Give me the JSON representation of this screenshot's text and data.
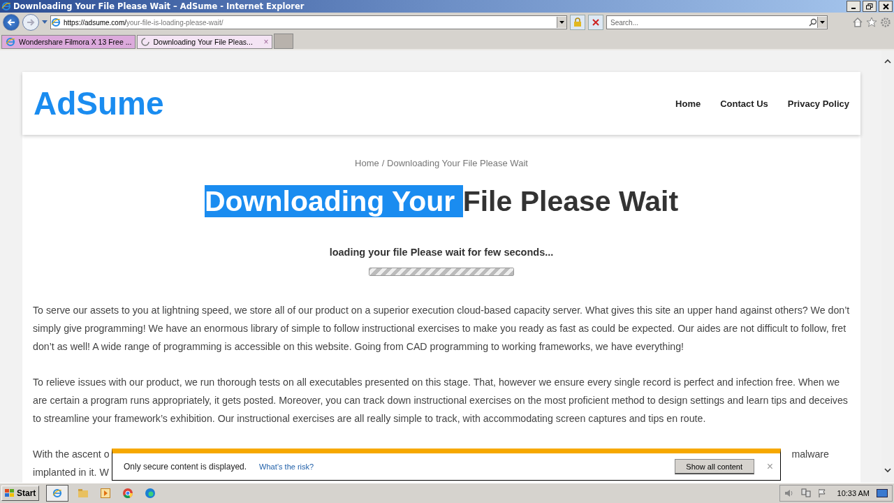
{
  "window": {
    "title": "Downloading Your File Please Wait – AdSume - Internet Explorer"
  },
  "address_bar": {
    "host": "https://adsume.com/",
    "path": "your-file-is-loading-please-wait/"
  },
  "search": {
    "placeholder": "Search..."
  },
  "tabs": [
    {
      "label": "Wondershare Filmora X 13 Free ...",
      "selected": false,
      "kind": "ie"
    },
    {
      "label": "Downloading Your File Pleas...",
      "selected": true,
      "kind": "loading",
      "close": "×"
    }
  ],
  "site": {
    "logo": "AdSume",
    "nav": [
      "Home",
      "Contact Us",
      "Privacy Policy"
    ]
  },
  "breadcrumb": {
    "home": "Home",
    "current": "/ Downloading Your File Please Wait"
  },
  "heading": {
    "selected_part": "Downloading Your ",
    "rest": "File Please Wait"
  },
  "loading": {
    "text": "loading your file Please wait for few seconds...",
    "level": 1
  },
  "paragraphs": [
    "To serve our assets to you at lightning speed, we store all of our product on a superior execution cloud-based capacity server. What gives this site an upper hand against others? We don’t simply give programming! We have an enormous library of simple to follow instructional exercises to make you ready as fast as could be expected. Our aides are not difficult to follow, fret don’t as well! A wide range of programming is accessible on this website. Going from CAD programming to working frameworks, we have everything!",
    "To relieve issues with our product, we run thorough tests on all executables presented on this stage. That, however we ensure every single record is perfect and infection free. When we are certain a program runs appropriately, it gets posted. Moreover, you can track down instructional exercises on the most proficient method to design settings and learn tips and deceives to streamline your framework’s exhibition. Our instructional exercises are all really simple to track, with accommodating screen captures and tips en route."
  ],
  "partial_paragraph": {
    "line1_left": "With the ascent o",
    "line1_right": "malware",
    "line2_left": "implanted in it. W"
  },
  "notification": {
    "message": "Only secure content is displayed.",
    "link": "What’s the risk?",
    "button": "Show all content",
    "close": "×"
  },
  "taskbar": {
    "start": "Start",
    "clock": "10:33 AM"
  }
}
